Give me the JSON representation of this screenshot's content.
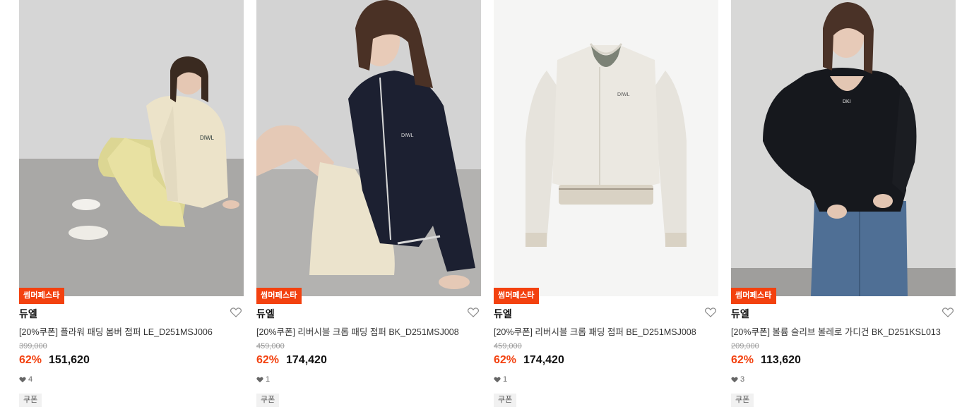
{
  "products": [
    {
      "tag": "썸머페스타",
      "brand": "듀엘",
      "name": "[20%쿠폰] 플라워 패딩 봄버 점퍼 LE_D251MSJ006",
      "original_price": "399,000",
      "discount": "62%",
      "price": "151,620",
      "likes": "4",
      "coupon": "쿠폰",
      "image": "model-cream-bomber-jacket"
    },
    {
      "tag": "썸머페스타",
      "brand": "듀엘",
      "name": "[20%쿠폰] 리버시블 크롭 패딩 점퍼 BK_D251MSJ008",
      "original_price": "459,000",
      "discount": "62%",
      "price": "174,420",
      "likes": "1",
      "coupon": "쿠폰",
      "image": "model-black-crop-padding-jumper"
    },
    {
      "tag": "썸머페스타",
      "brand": "듀엘",
      "name": "[20%쿠폰] 리버시블 크롭 패딩 점퍼 BE_D251MSJ008",
      "original_price": "459,000",
      "discount": "62%",
      "price": "174,420",
      "likes": "1",
      "coupon": "쿠폰",
      "image": "beige-crop-padding-jumper-product"
    },
    {
      "tag": "썸머페스타",
      "brand": "듀엘",
      "name": "[20%쿠폰] 볼륨 슬리브 볼레로 가디건 BK_D251KSL013",
      "original_price": "209,000",
      "discount": "62%",
      "price": "113,620",
      "likes": "3",
      "coupon": "쿠폰",
      "image": "model-black-bolero-cardigan"
    }
  ],
  "colors": {
    "accent": "#f3410f",
    "text": "#111111",
    "muted": "#999999"
  }
}
